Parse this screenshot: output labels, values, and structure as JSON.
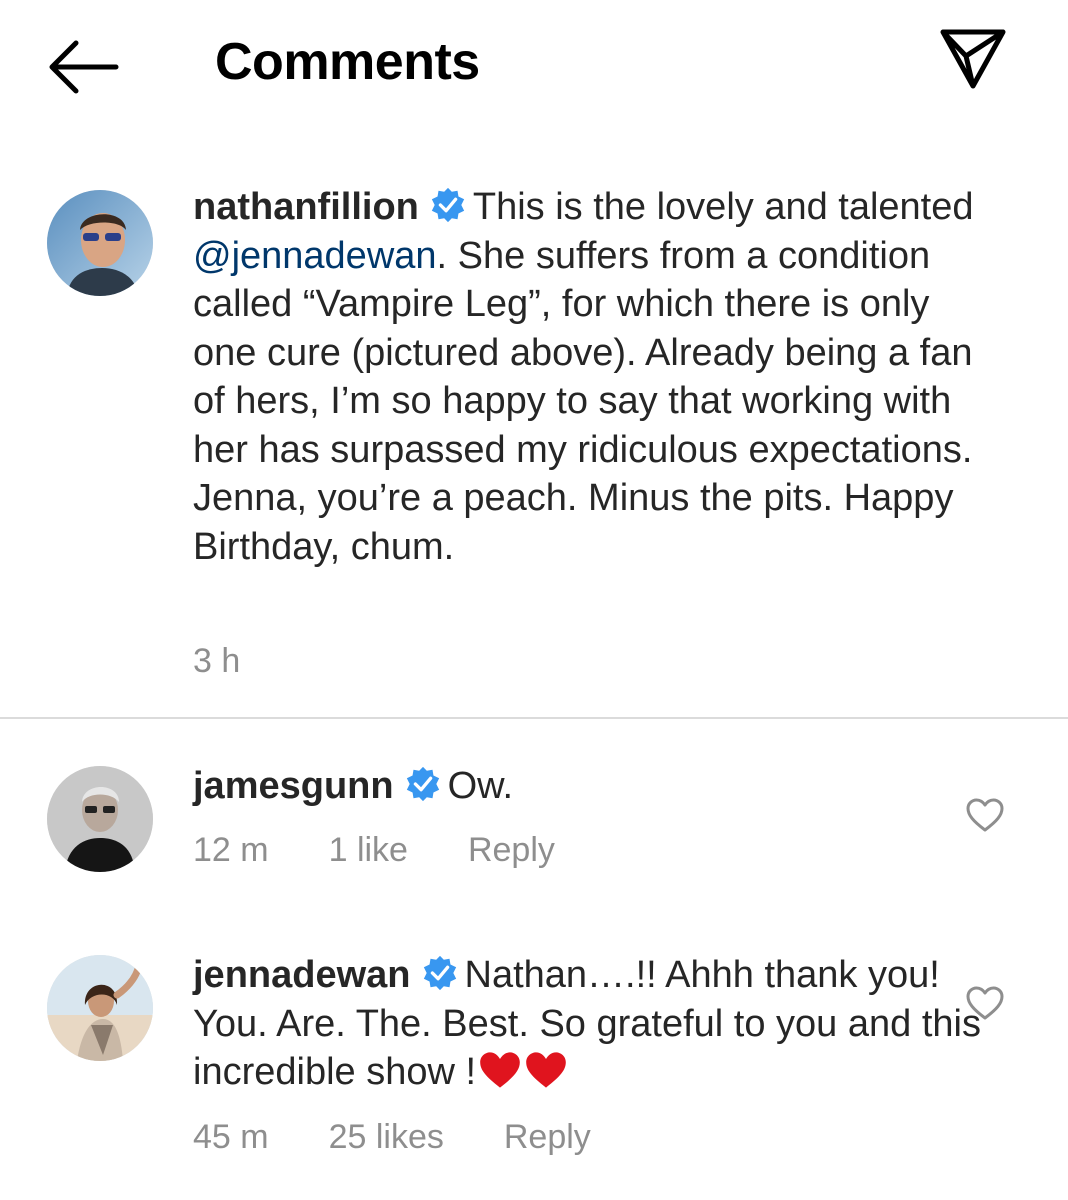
{
  "header": {
    "back_icon": "arrow-left-icon",
    "title": "Comments",
    "share_icon": "paper-plane-icon"
  },
  "caption": {
    "username": "nathanfillion",
    "verified": true,
    "text_before_mention": "This is the lovely and talented ",
    "mention": "@jennadewan",
    "text_after_mention": ". She suffers from a condition called “Vampire Leg”, for which there is only one cure (pictured above). Already being a fan of hers, I’m so happy to say that working with her has surpassed my ridiculous expectations. Jenna, you’re a peach. Minus the pits. Happy Birthday, chum.",
    "time": "3 h"
  },
  "comments": [
    {
      "username": "jamesgunn",
      "verified": true,
      "text": "Ow.",
      "time": "12 m",
      "likes": "1 like",
      "reply_label": "Reply"
    },
    {
      "username": "jennadewan",
      "verified": true,
      "text": "Nathan….!! Ahhh thank you! You. Are. The. Best. So grateful to you and this incredible show !",
      "emoji": [
        "red-heart",
        "red-heart"
      ],
      "time": "45 m",
      "likes": "25 likes",
      "reply_label": "Reply"
    }
  ],
  "colors": {
    "verified_badge": "#3897f0",
    "mention": "#00376b",
    "meta_text": "#8e8e8e",
    "divider": "#dbdbdb",
    "emoji_heart": "#e0141e"
  }
}
